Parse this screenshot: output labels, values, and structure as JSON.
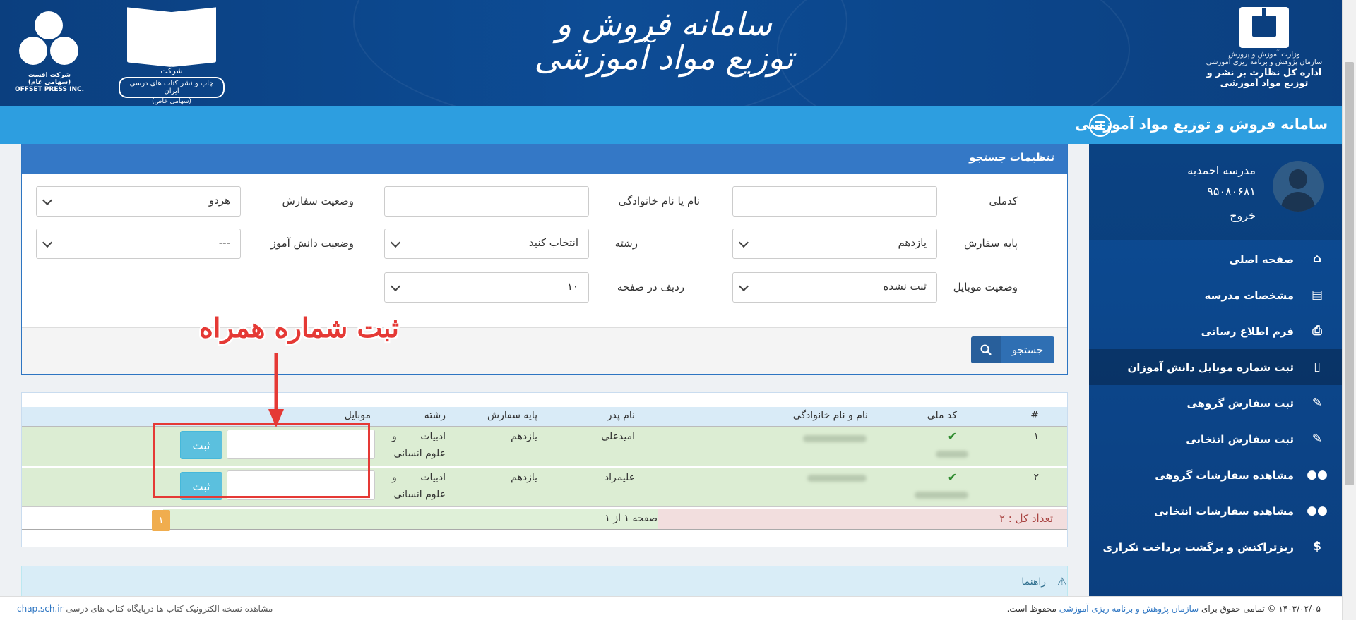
{
  "header": {
    "system_title": "سامانه فروش و توزیع مواد آموزشی",
    "ministry_lines": [
      "وزارت آموزش و پرورش",
      "سازمان پژوهش و برنامه ریزی آموزشی",
      "اداره کل نظارت بر نشر و توزیع مواد آموزشی"
    ],
    "publisher_lines": [
      "شرکت",
      "چاپ و نشر کتاب های درسی ایران",
      "(سهامی خاص)"
    ],
    "offset_lines": [
      "شرکت افست (سهامی عام)",
      "OFFSET PRESS INC."
    ]
  },
  "navbar": {
    "title": "سامانه فروش و توزیع مواد آموزشی"
  },
  "profile": {
    "school_name": "مدرسه احمدیه",
    "school_code": "۹۵۰۸۰۶۸۱",
    "logout": "خروج"
  },
  "sidebar": {
    "items": [
      {
        "label": "صفحه اصلی",
        "icon": "home-icon"
      },
      {
        "label": "مشخصات مدرسه",
        "icon": "id-card-icon"
      },
      {
        "label": "فرم اطلاع رسانی",
        "icon": "print-icon"
      },
      {
        "label": "ثبت شماره موبایل دانش آموزان",
        "icon": "mobile-icon"
      },
      {
        "label": "ثبت سفارش گروهی",
        "icon": "edit-icon"
      },
      {
        "label": "ثبت سفارش انتخابی",
        "icon": "edit-icon"
      },
      {
        "label": "مشاهده سفارشات گروهی",
        "icon": "users-icon"
      },
      {
        "label": "مشاهده سفارشات انتخابی",
        "icon": "users-icon"
      },
      {
        "label": "ریزتراکنش و برگشت پرداخت تکراری",
        "icon": "dollar-icon"
      }
    ],
    "active_index": 3
  },
  "search": {
    "panel_title": "تنظیمات جستجو",
    "national_code_label": "کدملی",
    "national_code_value": "",
    "name_label": "نام یا نام خانوادگی",
    "name_value": "",
    "order_status_label": "وضعیت سفارش",
    "order_status_value": "هردو",
    "grade_label": "پایه سفارش",
    "grade_value": "یازدهم",
    "field_label": "رشته",
    "field_value": "انتخاب کنید",
    "student_status_label": "وضعیت دانش آموز",
    "student_status_value": "---",
    "mobile_status_label": "وضعیت موبایل",
    "mobile_status_value": "ثبت نشده",
    "rows_per_page_label": "ردیف در صفحه",
    "rows_per_page_value": "۱۰",
    "search_button": "جستجو"
  },
  "table": {
    "headers": {
      "num": "#",
      "national_code": "کد ملی",
      "full_name": "نام و نام خانوادگی",
      "father": "نام پدر",
      "grade": "پایه سفارش",
      "field": "رشته",
      "mobile": "موبایل"
    },
    "rows": [
      {
        "num": "۱",
        "father": "امیدعلی",
        "grade": "یازدهم",
        "field_line1": "ادبیات و",
        "field_line2": "علوم انسانی",
        "save": "ثبت"
      },
      {
        "num": "۲",
        "father": "علیمراد",
        "grade": "یازدهم",
        "field_line1": "ادبیات و",
        "field_line2": "علوم انسانی",
        "save": "ثبت"
      }
    ],
    "total": "تعداد کل : ۲",
    "page_info": "صفحه ۱ از ۱",
    "page_number": "۱"
  },
  "annotation": {
    "text": "ثبت شماره همراه"
  },
  "guide": {
    "label": "راهنما"
  },
  "footer": {
    "copyright_prefix": "۱۴۰۳/۰۲/۰۵ © تمامی حقوق برای",
    "copyright_link": "سازمان پژوهش و برنامه ریزی آموزشی",
    "copyright_suffix": "محفوظ است.",
    "ebook_text": "مشاهده نسخه الکترونیک کتاب ها درپایگاه کتاب های درسی",
    "ebook_link": "chap.sch.ir"
  },
  "colors": {
    "header_blue": "#0d4c95",
    "navbar_blue": "#2d9ee0",
    "row_green": "#dcedd3",
    "annotation_red": "#e53935",
    "save_button": "#5bc0de"
  }
}
